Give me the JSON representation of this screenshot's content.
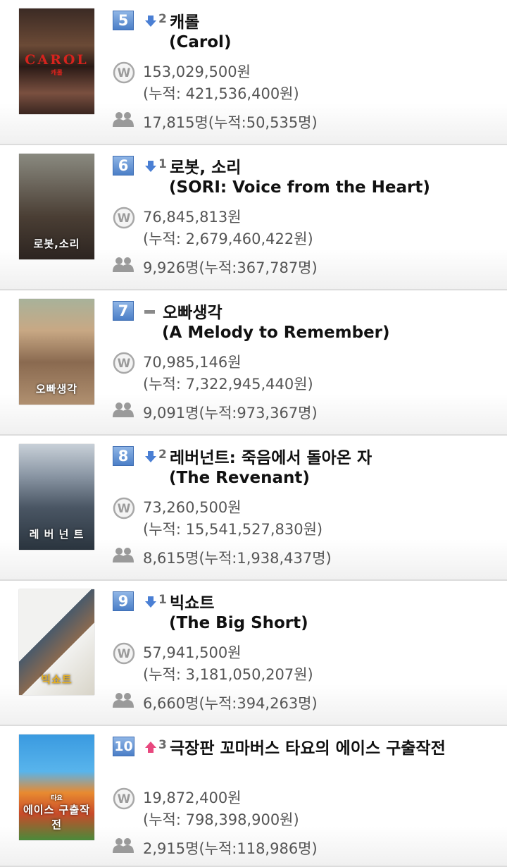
{
  "movies": [
    {
      "rank": "5",
      "change_direction": "down",
      "change_amount": "2",
      "title_ko": "캐롤",
      "title_en": "(Carol)",
      "sales": "153,029,500원",
      "sales_total": "(누적: 421,536,400원)",
      "audience": "17,815명(누적:50,535명)",
      "poster_text": "CAROL",
      "poster_subtext": "캐롤"
    },
    {
      "rank": "6",
      "change_direction": "down",
      "change_amount": "1",
      "title_ko": "로봇, 소리",
      "title_en": "(SORI: Voice from the Heart)",
      "sales": "76,845,813원",
      "sales_total": "(누적: 2,679,460,422원)",
      "audience": "9,926명(누적:367,787명)",
      "poster_text": "로봇,소리",
      "poster_subtext": ""
    },
    {
      "rank": "7",
      "change_direction": "same",
      "change_amount": "",
      "title_ko": "오빠생각",
      "title_en": "(A Melody to Remember)",
      "sales": "70,985,146원",
      "sales_total": "(누적: 7,322,945,440원)",
      "audience": "9,091명(누적:973,367명)",
      "poster_text": "오빠생각",
      "poster_subtext": ""
    },
    {
      "rank": "8",
      "change_direction": "down",
      "change_amount": "2",
      "title_ko": "레버넌트: 죽음에서 돌아온 자",
      "title_en": "(The Revenant)",
      "sales": "73,260,500원",
      "sales_total": "(누적: 15,541,527,830원)",
      "audience": "8,615명(누적:1,938,437명)",
      "poster_text": "레 버 넌 트",
      "poster_subtext": ""
    },
    {
      "rank": "9",
      "change_direction": "down",
      "change_amount": "1",
      "title_ko": "빅쇼트",
      "title_en": "(The Big Short)",
      "sales": "57,941,500원",
      "sales_total": "(누적: 3,181,050,207원)",
      "audience": "6,660명(누적:394,263명)",
      "poster_text": "빅쇼트",
      "poster_subtext": ""
    },
    {
      "rank": "10",
      "change_direction": "up",
      "change_amount": "3",
      "title_ko": "극장판 꼬마버스 타요의 에이스 구출작전",
      "title_en": "",
      "sales": "19,872,400원",
      "sales_total": "(누적: 798,398,900원)",
      "audience": "2,915명(누적:118,986명)",
      "poster_text": "에이스 구출작전",
      "poster_subtext": "타요"
    }
  ],
  "colors": {
    "rank_badge": "#5a8bd0",
    "down_arrow": "#4a7fd4",
    "up_arrow": "#e8487e",
    "text_dark": "#111111",
    "text_gray": "#555555"
  }
}
